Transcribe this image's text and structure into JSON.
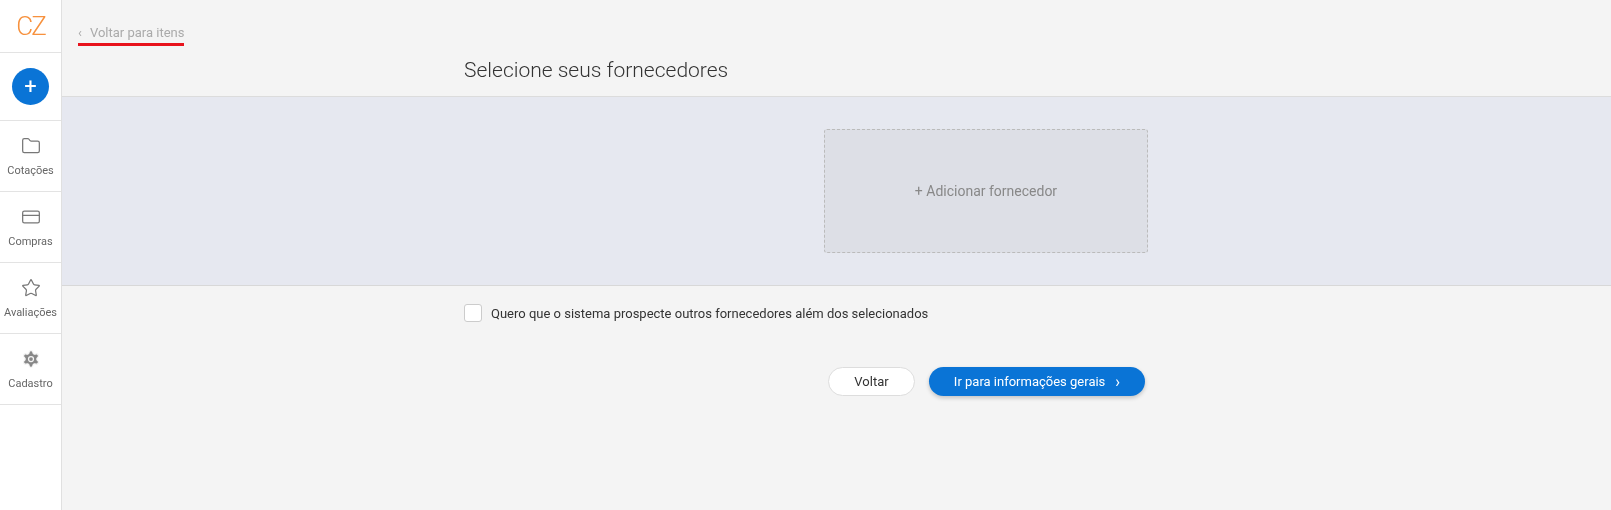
{
  "sidebar": {
    "logo": "CZ",
    "add_button": "+",
    "items": [
      {
        "kind": "folder",
        "label": "Cotações"
      },
      {
        "kind": "card",
        "label": "Compras"
      },
      {
        "kind": "star",
        "label": "Avaliações"
      },
      {
        "kind": "gear",
        "label": "Cadastro"
      }
    ]
  },
  "back_link": {
    "icon": "‹",
    "label": "Voltar para itens"
  },
  "title": "Selecione seus fornecedores",
  "add_supplier": "+ Adicionar fornecedor",
  "prospect_checkbox": {
    "label": "Quero que o sistema prospecte outros fornecedores além dos selecionados",
    "checked": false
  },
  "buttons": {
    "back": "Voltar",
    "next": "Ir para informações gerais",
    "next_icon": "›"
  }
}
